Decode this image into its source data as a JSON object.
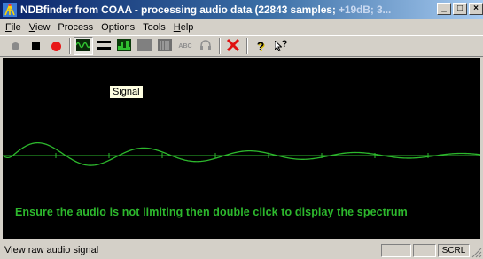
{
  "window": {
    "title_main": "NDBfinder from COAA - processing audio data (22843 samples; ",
    "title_dim": "+19dB; 3...",
    "minimize_glyph": "_",
    "maximize_glyph": "□",
    "close_glyph": "×"
  },
  "menu": [
    {
      "u": "F",
      "rest": "ile"
    },
    {
      "u": "V",
      "rest": "iew"
    },
    {
      "u": "",
      "rest": "Process"
    },
    {
      "u": "",
      "rest": "Options"
    },
    {
      "u": "",
      "rest": "Tools"
    },
    {
      "u": "H",
      "rest": "elp"
    }
  ],
  "toolbar": {
    "abc_label": "ABC",
    "help_glyph": "?",
    "context_help_glyph": "?",
    "colors": {
      "record_dim": "#8a8a8a",
      "record_red": "#e81818",
      "close_red": "#e01010",
      "signal_green": "#30c030"
    }
  },
  "display": {
    "tooltip": "Signal",
    "message": "Ensure the audio is not limiting then double click to display the spectrum",
    "colors": {
      "background": "#000000",
      "trace": "#2db82d",
      "text": "#2db82d"
    }
  },
  "statusbar": {
    "text": "View raw audio signal",
    "panel1": "",
    "panel2": "",
    "scrl": "SCRL"
  }
}
